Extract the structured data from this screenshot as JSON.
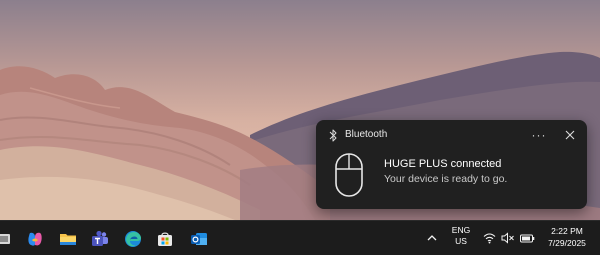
{
  "toast": {
    "app_name": "Bluetooth",
    "more_label": "···",
    "title": "HUGE PLUS connected",
    "message": "Your device is ready to go.",
    "icon": "mouse-icon",
    "app_icon": "bluetooth-icon"
  },
  "taskbar": {
    "apps": [
      {
        "name": "task-view",
        "icon": "task-view-icon"
      },
      {
        "name": "copilot",
        "icon": "copilot-icon"
      },
      {
        "name": "file-explorer",
        "icon": "folder-icon"
      },
      {
        "name": "teams",
        "icon": "teams-icon"
      },
      {
        "name": "edge",
        "icon": "edge-icon"
      },
      {
        "name": "microsoft-store",
        "icon": "store-icon"
      },
      {
        "name": "outlook",
        "icon": "outlook-icon"
      }
    ],
    "tray": {
      "language_line1": "ENG",
      "language_line2": "US",
      "time": "2:22 PM",
      "date": "7/29/2025"
    }
  },
  "colors": {
    "toast_bg": "#202020",
    "taskbar_bg": "#1c1c1c",
    "accent": "#0078d4"
  }
}
